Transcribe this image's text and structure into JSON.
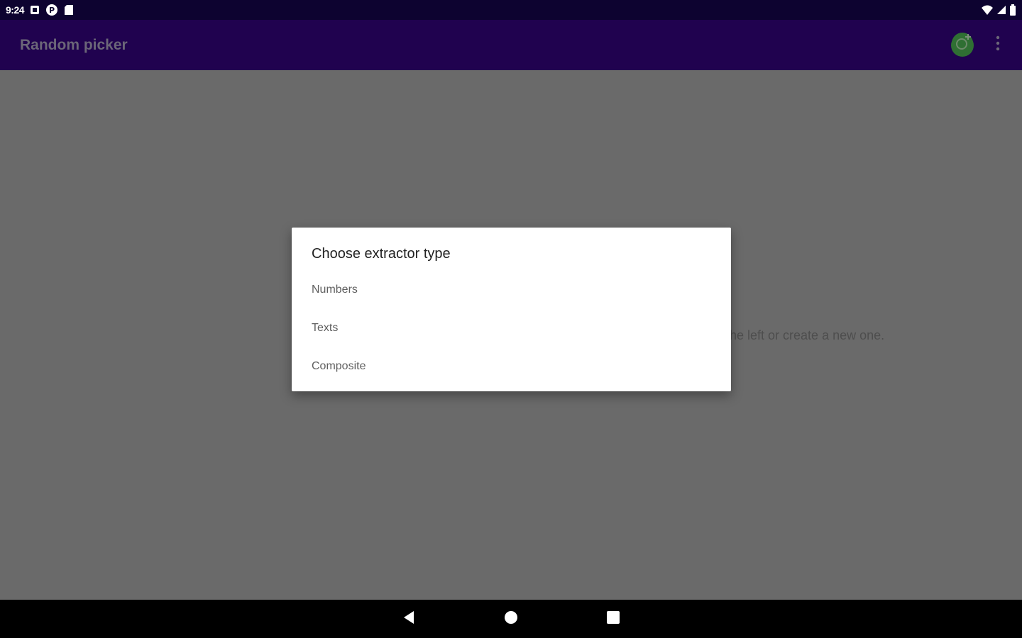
{
  "status_bar": {
    "time": "9:24",
    "left_icons": [
      "notification-square-icon",
      "play-circle-icon",
      "sd-card-icon"
    ],
    "right_icons": [
      "wifi-icon",
      "cell-signal-icon",
      "battery-icon"
    ]
  },
  "app_bar": {
    "title": "Random picker",
    "actions": [
      "add-extractor-icon",
      "more-vert-icon"
    ],
    "accent": "#20024f"
  },
  "main": {
    "empty_message": "he left or create a new one."
  },
  "dialog": {
    "title": "Choose extractor type",
    "options": [
      {
        "label": "Numbers"
      },
      {
        "label": "Texts"
      },
      {
        "label": "Composite"
      }
    ]
  },
  "nav_bar": {
    "buttons": [
      "back-icon",
      "home-icon",
      "recents-icon"
    ]
  }
}
